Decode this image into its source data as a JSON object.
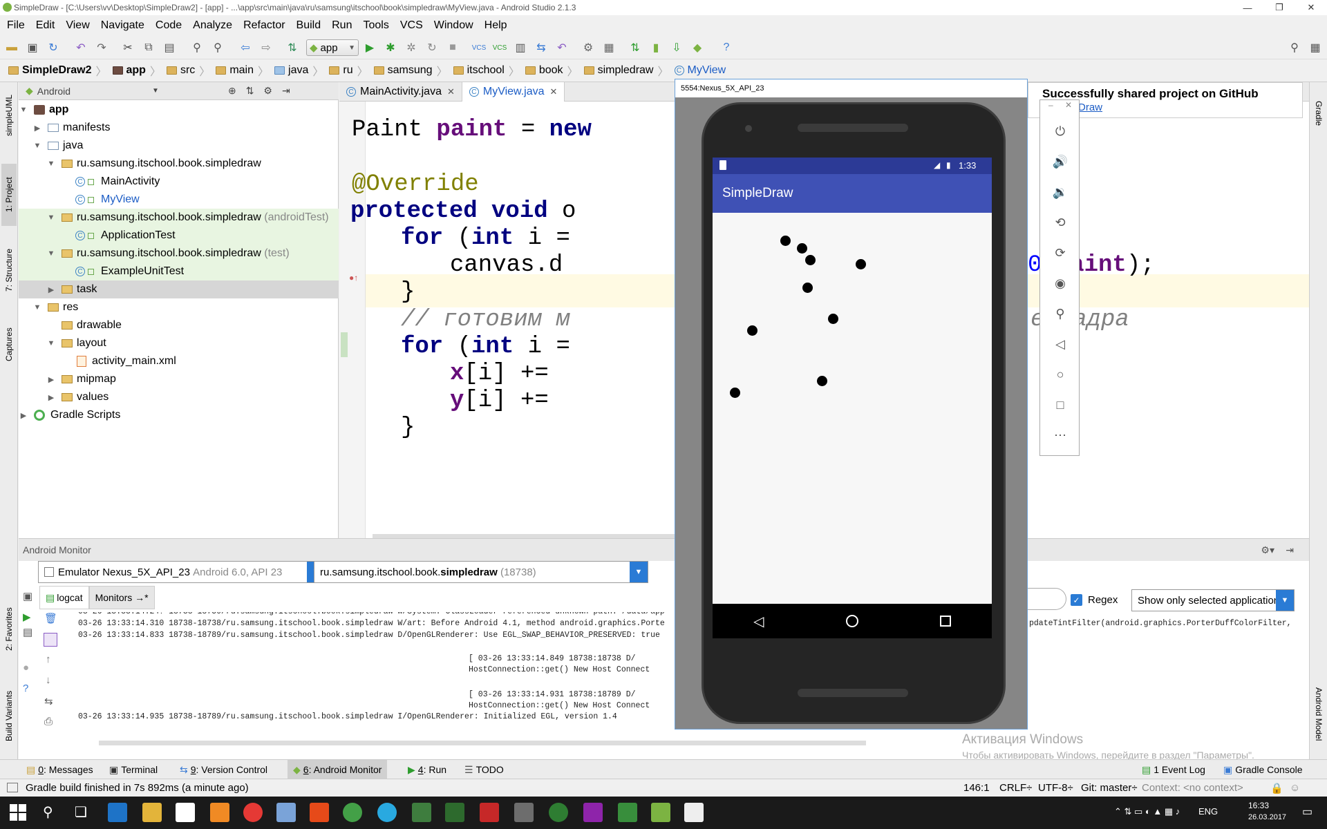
{
  "titlebar": {
    "title": "SimpleDraw - [C:\\Users\\vv\\Desktop\\SimpleDraw2] - [app] - ...\\app\\src\\main\\java\\ru\\samsung\\itschool\\book\\simpledraw\\MyView.java - Android Studio 2.1.3"
  },
  "menu": [
    "File",
    "Edit",
    "View",
    "Navigate",
    "Code",
    "Analyze",
    "Refactor",
    "Build",
    "Run",
    "Tools",
    "VCS",
    "Window",
    "Help"
  ],
  "toolbar": {
    "run_config": "app"
  },
  "breadcrumb": [
    "SimpleDraw2",
    "app",
    "src",
    "main",
    "java",
    "ru",
    "samsung",
    "itschool",
    "book",
    "simpledraw",
    "MyView"
  ],
  "left_tabs": [
    "simpleUML",
    "1: Project",
    "7: Structure",
    "Captures",
    "2: Favorites",
    "Build Variants"
  ],
  "right_tabs": [
    "Gradle",
    "Android Model"
  ],
  "project": {
    "view_mode": "Android",
    "tree": [
      {
        "label": "app",
        "bold": true
      },
      {
        "label": "manifests"
      },
      {
        "label": "java"
      },
      {
        "label": "ru.samsung.itschool.book.simpledraw"
      },
      {
        "label": "MainActivity"
      },
      {
        "label": "MyView"
      },
      {
        "label": "ru.samsung.itschool.book.simpledraw",
        "suffix": "(androidTest)"
      },
      {
        "label": "ApplicationTest"
      },
      {
        "label": "ru.samsung.itschool.book.simpledraw",
        "suffix": "(test)"
      },
      {
        "label": "ExampleUnitTest"
      },
      {
        "label": "task"
      },
      {
        "label": "res"
      },
      {
        "label": "drawable"
      },
      {
        "label": "layout"
      },
      {
        "label": "activity_main.xml"
      },
      {
        "label": "mipmap"
      },
      {
        "label": "values"
      },
      {
        "label": "Gradle Scripts"
      }
    ]
  },
  "editor": {
    "tabs": [
      {
        "label": "MainActivity.java"
      },
      {
        "label": "MyView.java",
        "active": true
      }
    ],
    "lines": {
      "l1a": "Paint ",
      "l1b": "paint",
      "l1c": " = ",
      "l1d": "new",
      "l2": "@Override",
      "l3a": "protected void",
      "l3b": " o",
      "l4a": "for",
      "l4b": " (",
      "l4c": "int",
      "l4d": " i =",
      "l5a": "canvas.d",
      "l5b": "0 ",
      "l5c": "paint",
      "l5d": ");",
      "l6": "}",
      "l7a": "// готовим м",
      "l7b": "е кадра",
      "l8a": "for",
      "l8b": " (",
      "l8c": "int",
      "l8d": " i =",
      "l9a": "x",
      "l9b": "[i] += ",
      "l10a": "y",
      "l10b": "[i] += ",
      "l11": "}"
    }
  },
  "monitor": {
    "title": "Android Monitor",
    "device": "Emulator Nexus_5X_API_23",
    "device_api": "Android 6.0, API 23",
    "process_prefix": "ru.samsung.itschool.book.",
    "process_bold": "simpledraw",
    "process_pid": "(18738)",
    "tabs": [
      "logcat",
      "Monitors →*"
    ],
    "regex_label": "Regex",
    "filter": "Show only selected application",
    "log": [
      "03-26 13:33:14.24? 18738-18750/ru.samsung.itschool.book.simpledraw W/System: ClassLoader referenced unknown path: /data/app",
      "03-26 13:33:14.310 18738-18738/ru.samsung.itschool.book.simpledraw W/art: Before Android 4.1, method android.graphics.Porte",
      "03-26 13:33:14.833 18738-18789/ru.samsung.itschool.book.simpledraw D/OpenGLRenderer: Use EGL_SWAP_BEHAVIOR_PRESERVED: true",
      "[ 03-26 13:33:14.849 18738:18738 D/",
      "HostConnection::get() New Host Connect",
      "[ 03-26 13:33:14.931 18738:18789 D/",
      "HostConnection::get() New Host Connect",
      "03-26 13:33:14.935 18738-18789/ru.samsung.itschool.book.simpledraw I/OpenGLRenderer: Initialized EGL, version 1.4"
    ],
    "log_right": "pdateTintFilter(android.graphics.PorterDuffColorFilter,"
  },
  "bottom_tabs": [
    {
      "num": "0",
      "label": ": Messages"
    },
    {
      "num": "",
      "label": "Terminal"
    },
    {
      "num": "9",
      "label": ": Version Control"
    },
    {
      "num": "6",
      "label": ": Android Monitor",
      "active": true
    },
    {
      "num": "4",
      "label": ": Run"
    },
    {
      "num": "",
      "label": "TODO"
    }
  ],
  "bottom_right": {
    "event_log_num": "1",
    "event_log": "Event Log",
    "gradle_console": "Gradle Console"
  },
  "status": {
    "message": "Gradle build finished in 7s 892ms (a minute ago)",
    "position": "146:1",
    "line_sep": "CRLF÷",
    "encoding": "UTF-8÷",
    "git": "Git: master÷",
    "context": "Context: <no context>"
  },
  "emulator": {
    "title": "5554:Nexus_5X_API_23",
    "time": "1:33",
    "app_title": "SimpleDraw",
    "points": [
      {
        "x": 0.26,
        "y": 0.07
      },
      {
        "x": 0.32,
        "y": 0.09
      },
      {
        "x": 0.35,
        "y": 0.12
      },
      {
        "x": 0.53,
        "y": 0.13
      },
      {
        "x": 0.34,
        "y": 0.19
      },
      {
        "x": 0.43,
        "y": 0.27
      },
      {
        "x": 0.14,
        "y": 0.3
      },
      {
        "x": 0.39,
        "y": 0.43
      },
      {
        "x": 0.08,
        "y": 0.46
      }
    ]
  },
  "notification": {
    "title": "Successfully shared project on GitHub",
    "link": "Draw"
  },
  "watermark": {
    "line1": "Активация Windows",
    "line2": "Чтобы активировать Windows, перейдите в раздел \"Параметры\"."
  },
  "taskbar": {
    "lang": "ENG",
    "time": "16:33",
    "date": "26.03.2017"
  }
}
